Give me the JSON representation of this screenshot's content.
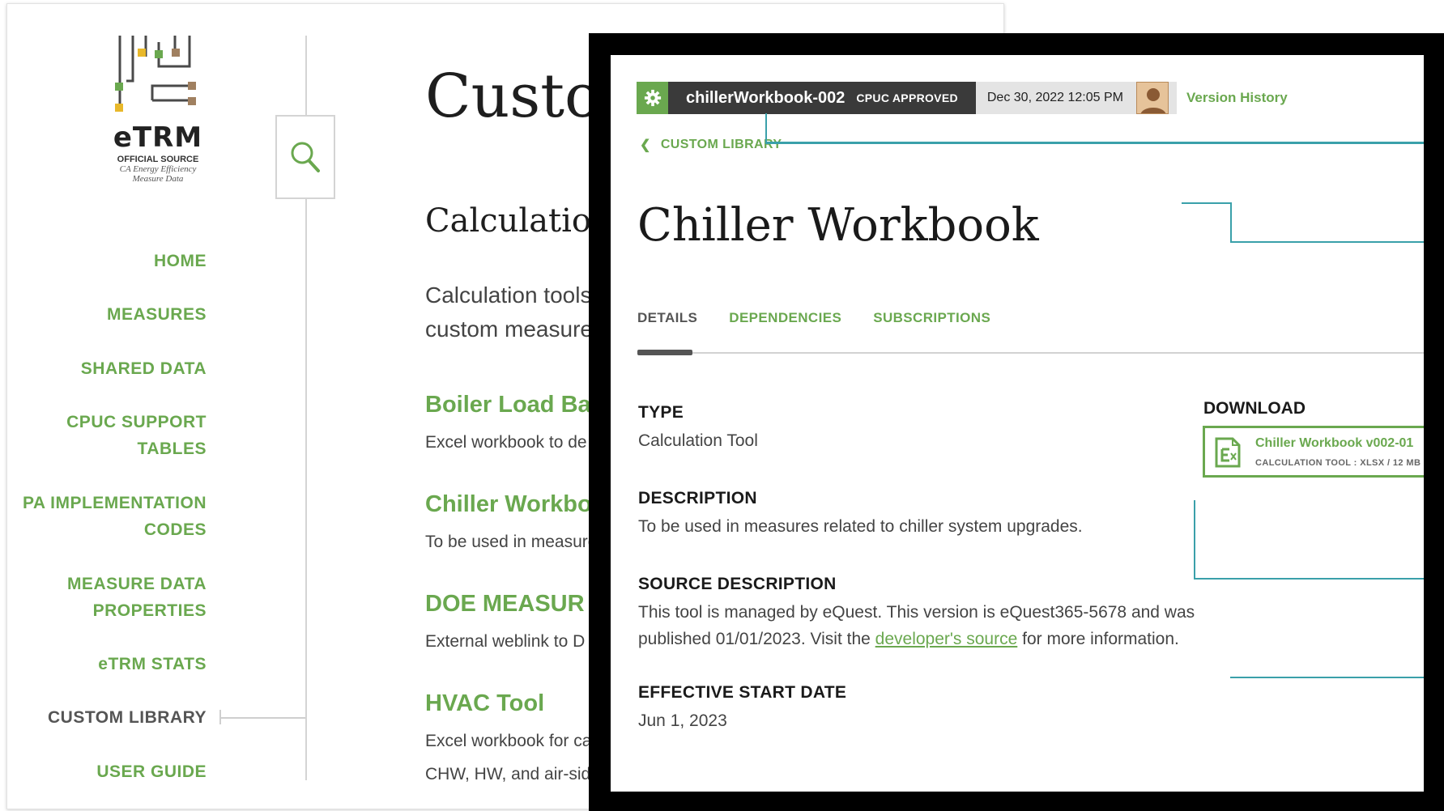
{
  "colors": {
    "accent_green": "#6aa84f",
    "teal": "#3aa0aa",
    "dark_bar": "#3a3a3a"
  },
  "logo": {
    "title": "eTRM",
    "subtitle": "OFFICIAL SOURCE",
    "tagline_1": "CA Energy Efficiency",
    "tagline_2": "Measure Data"
  },
  "sidebar": {
    "search_icon": "search-icon",
    "items": [
      {
        "label": "HOME"
      },
      {
        "label": "MEASURES"
      },
      {
        "label": "SHARED DATA"
      },
      {
        "label_1": "CPUC SUPPORT",
        "label_2": "TABLES"
      },
      {
        "label_1": "PA IMPLEMENTATION",
        "label_2": "CODES"
      },
      {
        "label_1": "MEASURE DATA",
        "label_2": "PROPERTIES"
      },
      {
        "label": "eTRM STATS"
      },
      {
        "label": "CUSTOM LIBRARY"
      },
      {
        "label": "USER GUIDE"
      }
    ]
  },
  "background_page": {
    "title": "Custom",
    "section_title": "Calculation",
    "intro_1": "Calculation tools",
    "intro_2": "custom measures",
    "tools": [
      {
        "name": "Boiler Load Ba",
        "desc": "Excel workbook to de"
      },
      {
        "name": "Chiller Workbo",
        "desc": "To be used in measure"
      },
      {
        "name": "DOE MEASUR",
        "desc": "External weblink to D"
      },
      {
        "name": "HVAC Tool",
        "desc": "Excel workbook for ca",
        "desc_2": "CHW, HW, and air-side"
      }
    ]
  },
  "header": {
    "gear_icon": "gear-icon",
    "name": "chillerWorkbook-002",
    "badge": "CPUC APPROVED",
    "date": "Dec 30, 2022 12:05 PM",
    "version_history": "Version History"
  },
  "breadcrumb": "CUSTOM LIBRARY",
  "page_title": "Chiller Workbook",
  "tabs": [
    {
      "label": "DETAILS",
      "active": true
    },
    {
      "label": "DEPENDENCIES",
      "active": false
    },
    {
      "label": "SUBSCRIPTIONS",
      "active": false
    }
  ],
  "details": {
    "type_label": "TYPE",
    "type_value": "Calculation Tool",
    "desc_label": "DESCRIPTION",
    "desc_value": "To be used in measures related to chiller system upgrades.",
    "source_label": "SOURCE DESCRIPTION",
    "source_line_1": "This tool is managed by eQuest. This version is eQuest365-5678 and was",
    "source_line_2_pre": "published 01/01/2023. Visit the ",
    "source_link": "developer's source",
    "source_line_2_post": " for more information.",
    "start_label": "EFFECTIVE START DATE",
    "start_value": "Jun 1, 2023"
  },
  "download": {
    "label": "DOWNLOAD",
    "file_name": "Chiller Workbook v002-01",
    "file_meta": "CALCULATION TOOL  :  XLSX  /  12 MB",
    "file_icon": "spreadsheet-file-icon"
  }
}
